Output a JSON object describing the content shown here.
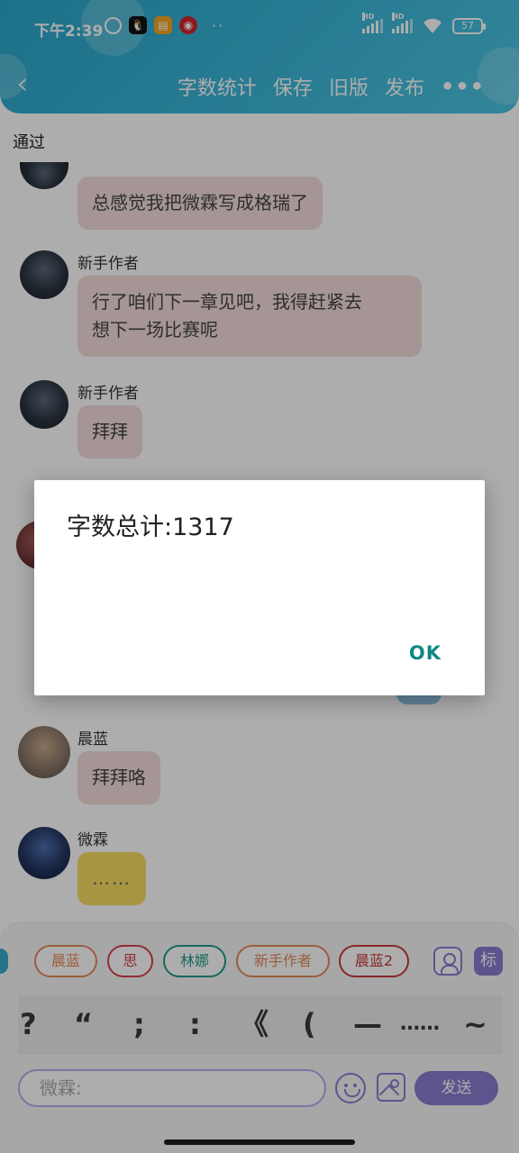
{
  "status_bar": {
    "time": "下午2:39",
    "more_dots": "··",
    "hd1": "HD",
    "hd2": "HD",
    "battery": "57"
  },
  "nav": {
    "back_glyph": "‹",
    "actions": [
      "字数统计",
      "保存",
      "旧版",
      "发布"
    ],
    "more_glyph": "•••"
  },
  "chat": {
    "pass_label": "通过",
    "messages": [
      {
        "sender": "",
        "text": "总感觉我把微霖写成格瑞了",
        "avatar": "dark-avatar"
      },
      {
        "sender": "新手作者",
        "text": "行了咱们下一章见吧，我得赶紧去\n想下一场比赛呢",
        "avatar": "dark-avatar"
      },
      {
        "sender": "新手作者",
        "text": "拜拜",
        "avatar": "dark-avatar"
      },
      {
        "sender": "晨蓝",
        "text": "拜拜咯",
        "avatar": "girl-avatar"
      },
      {
        "sender": "微霖",
        "text": "……",
        "avatar": "boy-avatar"
      }
    ]
  },
  "characters": [
    "晨蓝",
    "思",
    "林娜",
    "新手作者",
    "晨蓝2"
  ],
  "character_colors": [
    "#e58a5b",
    "#d8414f",
    "#1f9b8c",
    "#e58a5b",
    "#c73a3a"
  ],
  "tag_icon_label": "标",
  "punctuation": [
    "?",
    "“",
    ";",
    ":",
    "《",
    "(",
    "—",
    "……",
    "~"
  ],
  "input": {
    "value": "微霖:"
  },
  "send_label": "发送",
  "dialog": {
    "message": "字数总计:1317",
    "ok_label": "OK"
  }
}
